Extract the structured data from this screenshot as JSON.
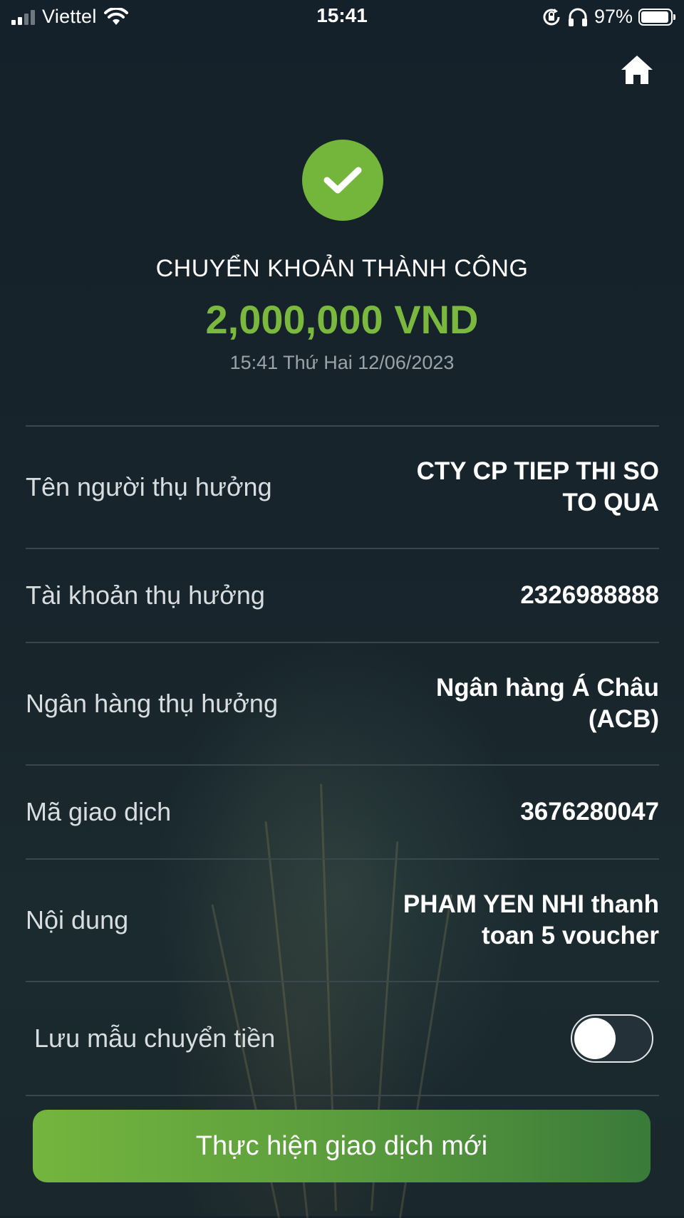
{
  "status_bar": {
    "carrier": "Viettel",
    "time": "15:41",
    "battery_percent": "97%",
    "battery_level": 0.97,
    "icons": [
      "cellular-signal-icon",
      "wifi-icon",
      "orientation-lock-icon",
      "headphones-icon",
      "battery-icon"
    ]
  },
  "header": {
    "home_icon": "home-icon"
  },
  "result": {
    "status_icon": "checkmark-icon",
    "title": "CHUYỂN KHOẢN THÀNH CÔNG",
    "amount": "2,000,000 VND",
    "timestamp": "15:41 Thứ Hai 12/06/2023"
  },
  "details": [
    {
      "label": "Tên người thụ hưởng",
      "value_lines": [
        "CTY CP TIEP THI SO",
        "TO QUA"
      ]
    },
    {
      "label": "Tài khoản thụ hưởng",
      "value_lines": [
        "2326988888"
      ]
    },
    {
      "label": "Ngân hàng thụ hưởng",
      "value_lines": [
        "Ngân hàng Á Châu",
        "(ACB)"
      ]
    },
    {
      "label": "Mã giao dịch",
      "value_lines": [
        "3676280047"
      ]
    },
    {
      "label": "Nội dung",
      "value_lines": [
        "PHAM YEN NHI thanh",
        "toan 5 voucher"
      ]
    }
  ],
  "save_template": {
    "label": "Lưu mẫu chuyển tiền",
    "enabled": false
  },
  "colors": {
    "accent_green": "#74b53c",
    "amount_green": "#7ab83e",
    "background": "#16232a",
    "divider": "#3b474d"
  },
  "actions": {
    "new_transaction_label": "Thực hiện giao dịch mới"
  }
}
